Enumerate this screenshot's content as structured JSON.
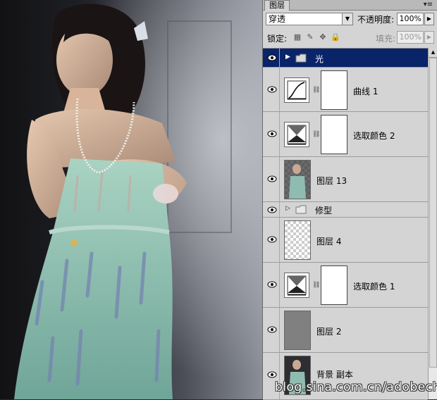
{
  "panel": {
    "tab_label": "图层",
    "menu_icon": "panel-menu-icon",
    "blend_mode": "穿透",
    "opacity_label": "不透明度:",
    "opacity_value": "100%",
    "lock_label": "锁定:",
    "fill_label": "填充:",
    "fill_value": "100%"
  },
  "layers": [
    {
      "name": "光",
      "type": "group",
      "selected": true
    },
    {
      "name": "曲线 1",
      "type": "adjustment-curves"
    },
    {
      "name": "选取颜色 2",
      "type": "adjustment-selective-color"
    },
    {
      "name": "图层 13",
      "type": "image"
    },
    {
      "name": "修型",
      "type": "group"
    },
    {
      "name": "图层 4",
      "type": "transparent"
    },
    {
      "name": "选取颜色 1",
      "type": "adjustment-selective-color"
    },
    {
      "name": "图层 2",
      "type": "gray-fill"
    },
    {
      "name": "背景 副本",
      "type": "image"
    }
  ],
  "watermark": "blog.sina.com.cn/adobech",
  "colors": {
    "selection": "#0a246a",
    "panel_bg": "#d4d4d4",
    "fill_gray": "#808080"
  }
}
